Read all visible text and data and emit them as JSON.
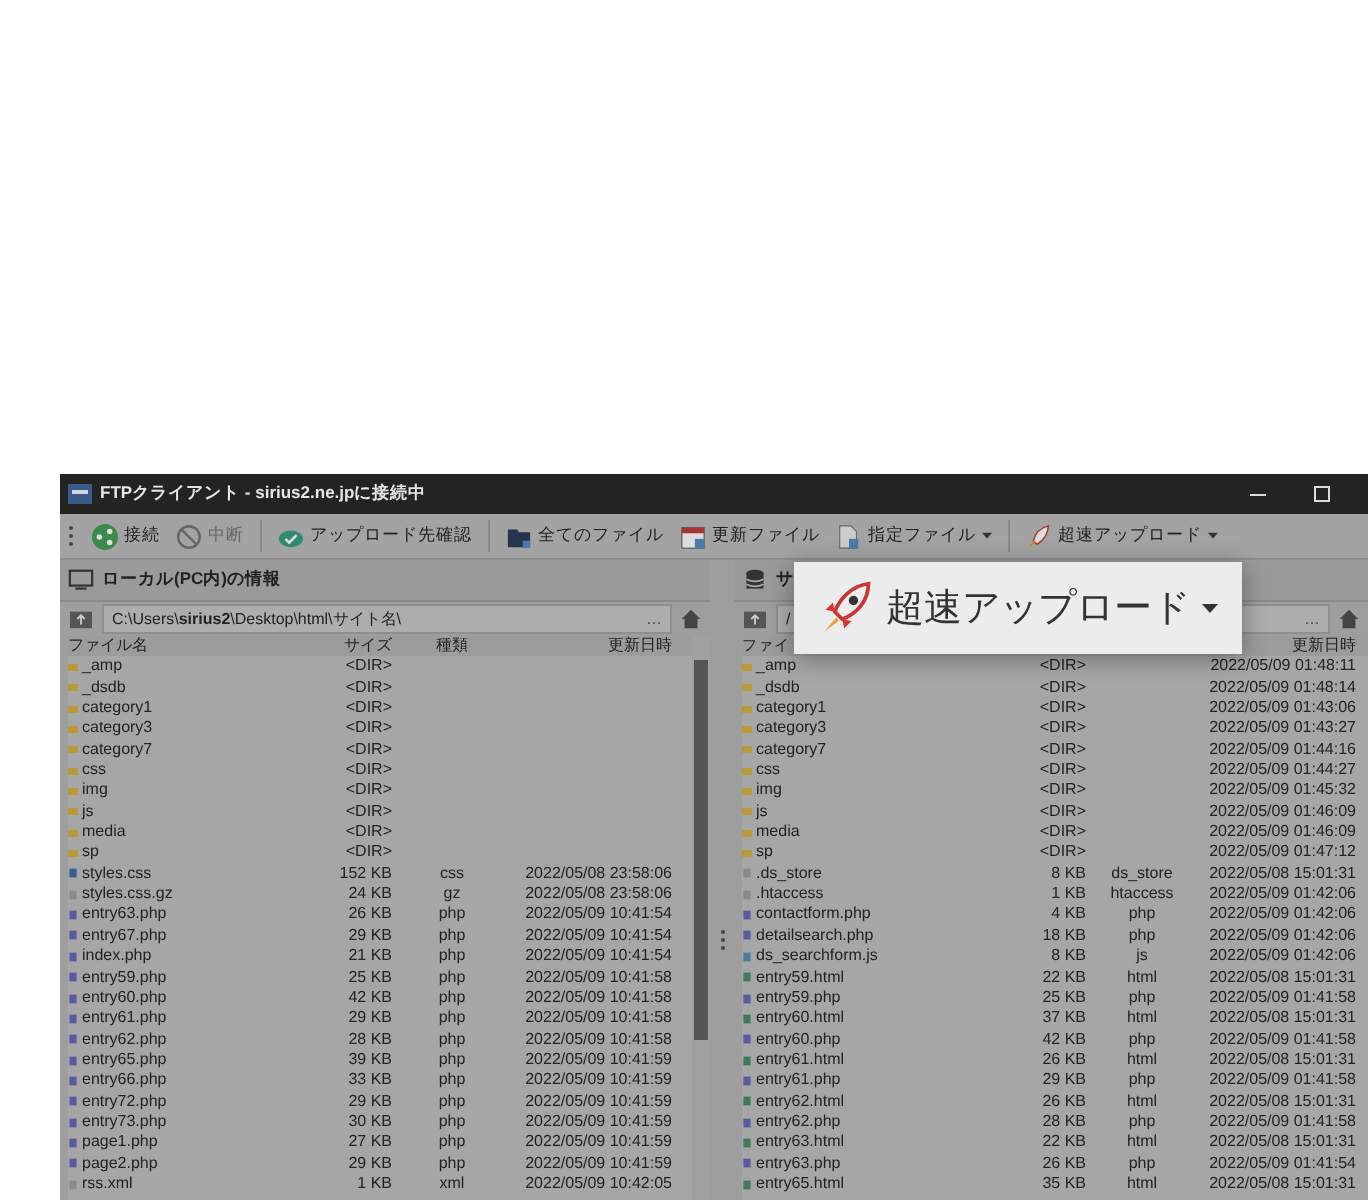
{
  "window": {
    "title": "FTPクライアント - sirius2.ne.jpに接続中"
  },
  "toolbar": [
    {
      "label": "接続",
      "disabled": false,
      "dropdown": false
    },
    {
      "label": "中断",
      "disabled": true,
      "dropdown": false
    },
    {
      "label": "アップロード先確認",
      "disabled": false,
      "dropdown": false
    },
    {
      "label": "全てのファイル",
      "disabled": false,
      "dropdown": false
    },
    {
      "label": "更新ファイル",
      "disabled": false,
      "dropdown": false
    },
    {
      "label": "指定ファイル",
      "disabled": false,
      "dropdown": true
    },
    {
      "label": "超速アップロード",
      "disabled": false,
      "dropdown": true
    }
  ],
  "local": {
    "header": "ローカル(PC内)の情報",
    "path": "C:\\Users\\**sirius2**\\Desktop\\html\\サイト名\\",
    "more": "…",
    "columns": {
      "name": "ファイル名",
      "size": "サイズ",
      "type": "種類",
      "modified": "更新日時"
    },
    "rows": [
      {
        "name": "_amp",
        "size": "<DIR>",
        "kind": "dir"
      },
      {
        "name": "_dsdb",
        "size": "<DIR>",
        "kind": "dir"
      },
      {
        "name": "category1",
        "size": "<DIR>",
        "kind": "dir"
      },
      {
        "name": "category3",
        "size": "<DIR>",
        "kind": "dir"
      },
      {
        "name": "category7",
        "size": "<DIR>",
        "kind": "dir"
      },
      {
        "name": "css",
        "size": "<DIR>",
        "kind": "dir"
      },
      {
        "name": "img",
        "size": "<DIR>",
        "kind": "dir"
      },
      {
        "name": "js",
        "size": "<DIR>",
        "kind": "dir"
      },
      {
        "name": "media",
        "size": "<DIR>",
        "kind": "dir"
      },
      {
        "name": "sp",
        "size": "<DIR>",
        "kind": "dir"
      },
      {
        "name": "styles.css",
        "size": "152 KB",
        "type": "css",
        "modified": "2022/05/08 23:58:06",
        "kind": "css"
      },
      {
        "name": "styles.css.gz",
        "size": "24 KB",
        "type": "gz",
        "modified": "2022/05/08 23:58:06",
        "kind": "file"
      },
      {
        "name": "entry63.php",
        "size": "26 KB",
        "type": "php",
        "modified": "2022/05/09 10:41:54",
        "kind": "php"
      },
      {
        "name": "entry67.php",
        "size": "29 KB",
        "type": "php",
        "modified": "2022/05/09 10:41:54",
        "kind": "php"
      },
      {
        "name": "index.php",
        "size": "21 KB",
        "type": "php",
        "modified": "2022/05/09 10:41:54",
        "kind": "php"
      },
      {
        "name": "entry59.php",
        "size": "25 KB",
        "type": "php",
        "modified": "2022/05/09 10:41:58",
        "kind": "php"
      },
      {
        "name": "entry60.php",
        "size": "42 KB",
        "type": "php",
        "modified": "2022/05/09 10:41:58",
        "kind": "php"
      },
      {
        "name": "entry61.php",
        "size": "29 KB",
        "type": "php",
        "modified": "2022/05/09 10:41:58",
        "kind": "php"
      },
      {
        "name": "entry62.php",
        "size": "28 KB",
        "type": "php",
        "modified": "2022/05/09 10:41:58",
        "kind": "php"
      },
      {
        "name": "entry65.php",
        "size": "39 KB",
        "type": "php",
        "modified": "2022/05/09 10:41:59",
        "kind": "php"
      },
      {
        "name": "entry66.php",
        "size": "33 KB",
        "type": "php",
        "modified": "2022/05/09 10:41:59",
        "kind": "php"
      },
      {
        "name": "entry72.php",
        "size": "29 KB",
        "type": "php",
        "modified": "2022/05/09 10:41:59",
        "kind": "php"
      },
      {
        "name": "entry73.php",
        "size": "30 KB",
        "type": "php",
        "modified": "2022/05/09 10:41:59",
        "kind": "php"
      },
      {
        "name": "page1.php",
        "size": "27 KB",
        "type": "php",
        "modified": "2022/05/09 10:41:59",
        "kind": "php"
      },
      {
        "name": "page2.php",
        "size": "29 KB",
        "type": "php",
        "modified": "2022/05/09 10:41:59",
        "kind": "php"
      },
      {
        "name": "rss.xml",
        "size": "1 KB",
        "type": "xml",
        "modified": "2022/05/09 10:42:05",
        "kind": "xml"
      }
    ]
  },
  "server": {
    "header": "サ",
    "path": "/",
    "more": "…",
    "columns": {
      "name": "ファイ",
      "modified": "更新日時"
    },
    "rows": [
      {
        "name": "_amp",
        "size": "<DIR>",
        "modified": "2022/05/09 01:48:11",
        "kind": "dir"
      },
      {
        "name": "_dsdb",
        "size": "<DIR>",
        "modified": "2022/05/09 01:48:14",
        "kind": "dir"
      },
      {
        "name": "category1",
        "size": "<DIR>",
        "modified": "2022/05/09 01:43:06",
        "kind": "dir"
      },
      {
        "name": "category3",
        "size": "<DIR>",
        "modified": "2022/05/09 01:43:27",
        "kind": "dir"
      },
      {
        "name": "category7",
        "size": "<DIR>",
        "modified": "2022/05/09 01:44:16",
        "kind": "dir"
      },
      {
        "name": "css",
        "size": "<DIR>",
        "modified": "2022/05/09 01:44:27",
        "kind": "dir"
      },
      {
        "name": "img",
        "size": "<DIR>",
        "modified": "2022/05/09 01:45:32",
        "kind": "dir"
      },
      {
        "name": "js",
        "size": "<DIR>",
        "modified": "2022/05/09 01:46:09",
        "kind": "dir"
      },
      {
        "name": "media",
        "size": "<DIR>",
        "modified": "2022/05/09 01:46:09",
        "kind": "dir"
      },
      {
        "name": "sp",
        "size": "<DIR>",
        "modified": "2022/05/09 01:47:12",
        "kind": "dir"
      },
      {
        "name": ".ds_store",
        "size": "8 KB",
        "type": "ds_store",
        "modified": "2022/05/08 15:01:31",
        "kind": "file"
      },
      {
        "name": ".htaccess",
        "size": "1 KB",
        "type": "htaccess",
        "modified": "2022/05/09 01:42:06",
        "kind": "file"
      },
      {
        "name": "contactform.php",
        "size": "4 KB",
        "type": "php",
        "modified": "2022/05/09 01:42:06",
        "kind": "php"
      },
      {
        "name": "detailsearch.php",
        "size": "18 KB",
        "type": "php",
        "modified": "2022/05/09 01:42:06",
        "kind": "php"
      },
      {
        "name": "ds_searchform.js",
        "size": "8 KB",
        "type": "js",
        "modified": "2022/05/09 01:42:06",
        "kind": "js"
      },
      {
        "name": "entry59.html",
        "size": "22 KB",
        "type": "html",
        "modified": "2022/05/08 15:01:31",
        "kind": "html"
      },
      {
        "name": "entry59.php",
        "size": "25 KB",
        "type": "php",
        "modified": "2022/05/09 01:41:58",
        "kind": "php"
      },
      {
        "name": "entry60.html",
        "size": "37 KB",
        "type": "html",
        "modified": "2022/05/08 15:01:31",
        "kind": "html"
      },
      {
        "name": "entry60.php",
        "size": "42 KB",
        "type": "php",
        "modified": "2022/05/09 01:41:58",
        "kind": "php"
      },
      {
        "name": "entry61.html",
        "size": "26 KB",
        "type": "html",
        "modified": "2022/05/08 15:01:31",
        "kind": "html"
      },
      {
        "name": "entry61.php",
        "size": "29 KB",
        "type": "php",
        "modified": "2022/05/09 01:41:58",
        "kind": "php"
      },
      {
        "name": "entry62.html",
        "size": "26 KB",
        "type": "html",
        "modified": "2022/05/08 15:01:31",
        "kind": "html"
      },
      {
        "name": "entry62.php",
        "size": "28 KB",
        "type": "php",
        "modified": "2022/05/09 01:41:58",
        "kind": "php"
      },
      {
        "name": "entry63.html",
        "size": "22 KB",
        "type": "html",
        "modified": "2022/05/08 15:01:31",
        "kind": "html"
      },
      {
        "name": "entry63.php",
        "size": "26 KB",
        "type": "php",
        "modified": "2022/05/09 01:41:54",
        "kind": "php"
      },
      {
        "name": "entry65.html",
        "size": "35 KB",
        "type": "html",
        "modified": "2022/05/08 15:01:31",
        "kind": "html"
      }
    ]
  },
  "callout": {
    "label": "超速アップロード",
    "dropdown": true
  }
}
